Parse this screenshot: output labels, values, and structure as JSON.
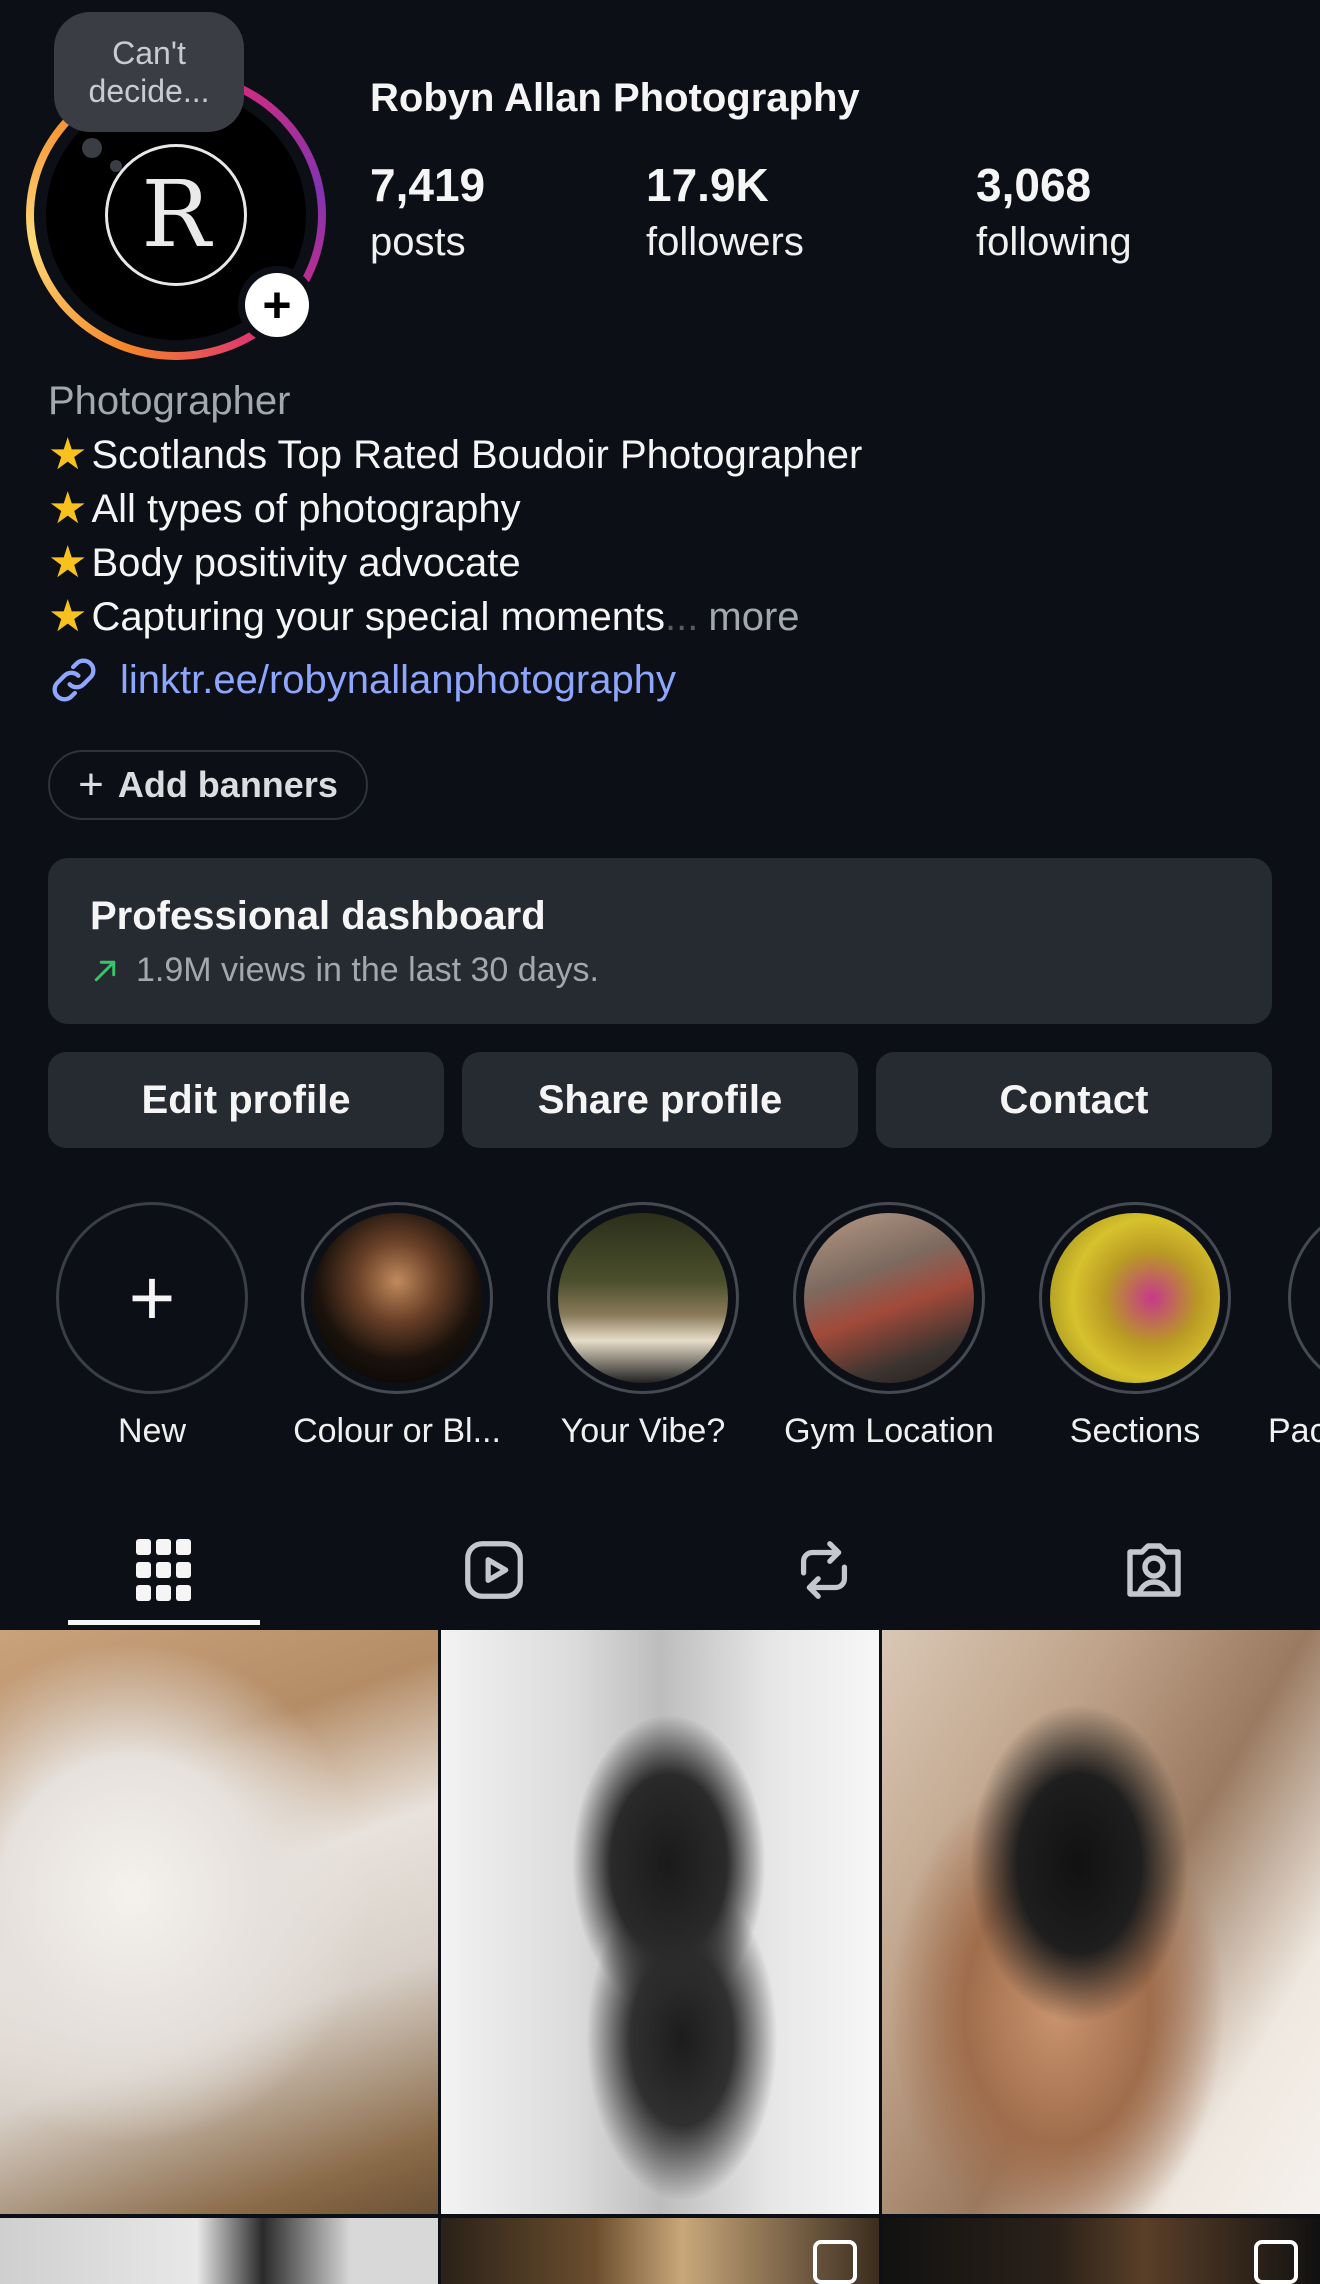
{
  "profile": {
    "note": "Can't decide...",
    "avatar_letter": "R",
    "name": "Robyn Allan Photography",
    "stats": {
      "posts": {
        "value": "7,419",
        "label": "posts"
      },
      "followers": {
        "value": "17.9K",
        "label": "followers"
      },
      "following": {
        "value": "3,068",
        "label": "following"
      }
    }
  },
  "bio": {
    "category": "Photographer",
    "lines": [
      "Scotlands Top Rated Boudoir Photographer",
      "All types of photography",
      "Body positivity advocate",
      "Capturing your special moments"
    ],
    "ellipsis": "...",
    "more": "more",
    "link": "linktr.ee/robynallanphotography"
  },
  "add_banners": {
    "label": "Add banners"
  },
  "dashboard": {
    "title": "Professional dashboard",
    "subtitle": "1.9M views in the last 30 days."
  },
  "buttons": {
    "edit": "Edit profile",
    "share": "Share profile",
    "contact": "Contact"
  },
  "highlights": [
    {
      "label": "New"
    },
    {
      "label": "Colour or Bl..."
    },
    {
      "label": "Your Vibe?"
    },
    {
      "label": "Gym Location"
    },
    {
      "label": "Sections"
    },
    {
      "label": "Pac"
    }
  ],
  "tabs": [
    "grid",
    "reels",
    "reposts",
    "tagged"
  ],
  "colors": {
    "background": "#0c1016",
    "card": "#262a31",
    "link": "#8fa6ff",
    "muted": "#a3a7ae",
    "trend_up": "#39c46a"
  }
}
